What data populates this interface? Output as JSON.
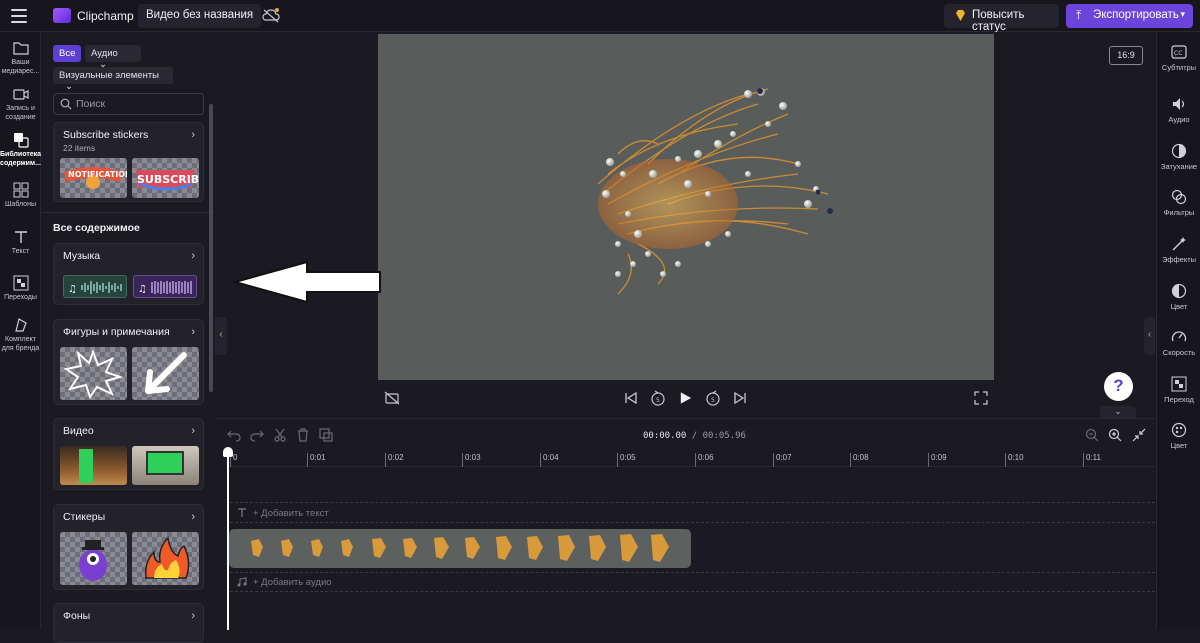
{
  "topbar": {
    "app_name": "Clipchamp",
    "video_title": "Видео без названия",
    "upgrade_label": "Повысить статус",
    "export_label": "Экспортировать"
  },
  "leftnav": [
    {
      "label": "Ваши медиарес...",
      "icon": "folder-icon"
    },
    {
      "label": "Запись и создание",
      "icon": "camera-icon"
    },
    {
      "label": "Библиотека содержим...",
      "icon": "library-icon",
      "active": true
    },
    {
      "label": "Шаблоны",
      "icon": "templates-icon"
    },
    {
      "label": "Текст",
      "icon": "text-icon"
    },
    {
      "label": "Переходы",
      "icon": "transitions-icon"
    },
    {
      "label": "Комплект для бренда",
      "icon": "brand-kit-icon"
    }
  ],
  "panel": {
    "filter_all": "Все",
    "filter_audio": "Аудио",
    "filter_visual": "Визуальные элементы",
    "search_placeholder": "Поиск",
    "stickers_card": {
      "title": "Subscribe stickers",
      "count": "22 items"
    },
    "all_content_title": "Все содержимое",
    "cards": [
      {
        "title": "Музыка"
      },
      {
        "title": "Фигуры и примечания"
      },
      {
        "title": "Видео"
      },
      {
        "title": "Стикеры"
      },
      {
        "title": "Фоны"
      }
    ]
  },
  "preview": {
    "aspect_ratio": "16:9",
    "help": "?"
  },
  "rightnav": [
    {
      "label": "Субтитры",
      "icon": "captions-icon"
    },
    {
      "label": "Аудио",
      "icon": "speaker-icon"
    },
    {
      "label": "Затухание",
      "icon": "fade-icon"
    },
    {
      "label": "Фильтры",
      "icon": "filters-icon"
    },
    {
      "label": "Эффекты",
      "icon": "effects-icon"
    },
    {
      "label": "Цвет",
      "icon": "color-icon"
    },
    {
      "label": "Скорость",
      "icon": "speed-icon"
    },
    {
      "label": "Переход",
      "icon": "transition-icon"
    },
    {
      "label": "Цвет",
      "icon": "color-wheel-icon"
    }
  ],
  "timeline": {
    "current_time": "00:00.00",
    "total_time": "/ 00:05.96",
    "ticks": [
      "0",
      "0:01",
      "0:02",
      "0:03",
      "0:04",
      "0:05",
      "0:06",
      "0:07",
      "0:08",
      "0:09",
      "0:10",
      "0:11"
    ],
    "add_text": "+ Добавить текст",
    "add_audio": "+ Добавить аудио"
  },
  "colors": {
    "accent": "#6b45d9",
    "background": "#1b1a22",
    "video_bg": "#585d5c"
  }
}
